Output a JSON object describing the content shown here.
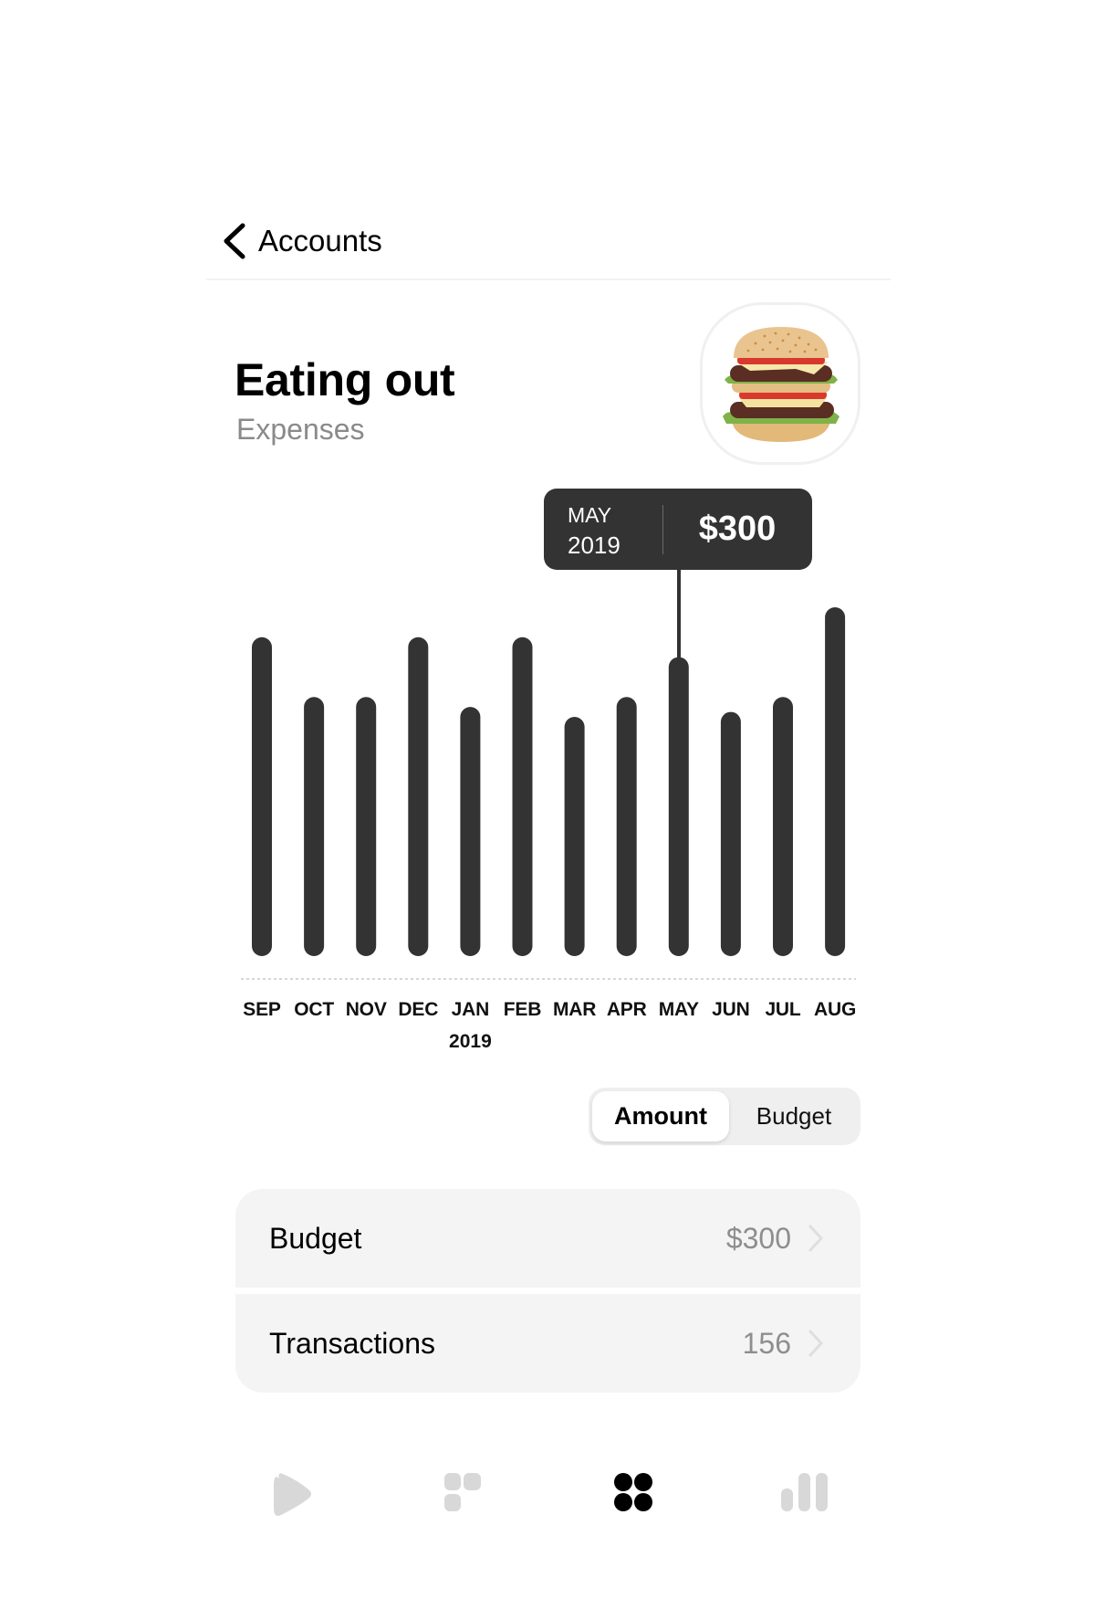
{
  "nav": {
    "back_label": "Accounts",
    "back_icon": "chevron-left-icon"
  },
  "header": {
    "title": "Eating out",
    "subtitle": "Expenses",
    "category_icon": "burger-icon"
  },
  "tooltip": {
    "month": "MAY",
    "year": "2019",
    "value": "$300"
  },
  "chart_data": {
    "type": "bar",
    "title": "",
    "xlabel": "",
    "ylabel": "",
    "categories": [
      "SEP",
      "OCT",
      "NOV",
      "DEC",
      "JAN",
      "FEB",
      "MAR",
      "APR",
      "MAY",
      "JUN",
      "JUL",
      "AUG"
    ],
    "values": [
      320,
      260,
      260,
      320,
      250,
      320,
      240,
      260,
      300,
      245,
      260,
      350
    ],
    "year_label": "2019",
    "year_label_under": "JAN",
    "selected_index": 8,
    "selected_label": "MAY 2019",
    "selected_value": 300,
    "ylim": [
      0,
      350
    ],
    "grid": false,
    "baseline": "dashed",
    "bar_color": "#333333"
  },
  "segmented": {
    "options": [
      "Amount",
      "Budget"
    ],
    "selected": "Amount"
  },
  "list": {
    "rows": [
      {
        "label": "Budget",
        "value": "$300"
      },
      {
        "label": "Transactions",
        "value": "156"
      }
    ]
  },
  "tabbar": {
    "items": [
      {
        "icon": "play-icon",
        "active": false
      },
      {
        "icon": "tiles-icon",
        "active": false
      },
      {
        "icon": "dots-grid-icon",
        "active": true
      },
      {
        "icon": "bar-chart-icon",
        "active": false
      }
    ],
    "active_color": "#000000",
    "inactive_color": "#d8d8d8"
  }
}
